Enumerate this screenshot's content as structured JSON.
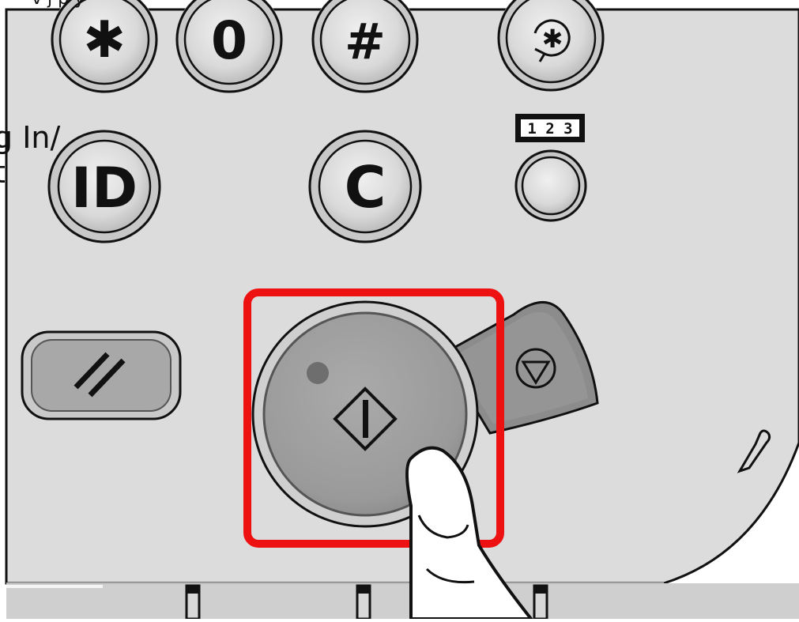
{
  "top_partial_text": "v j p y",
  "side_label": "g In/\nt",
  "keys": {
    "asterisk": "✱",
    "zero": "0",
    "hash": "#",
    "id": "ID",
    "clear": "C"
  },
  "counter_badge": "1 2 3",
  "colors": {
    "panel": "#dddddd",
    "outline": "#111111",
    "highlight": "#ee1111",
    "start_button": "#9c9c9c",
    "stop_button": "#8a8a8a"
  },
  "icons": {
    "top_right": "energy-saver-icon",
    "reset": "reset-icon",
    "start": "start-icon",
    "stop": "stop-icon",
    "pencil": "pencil-icon",
    "finger": "finger-pointer-icon"
  }
}
